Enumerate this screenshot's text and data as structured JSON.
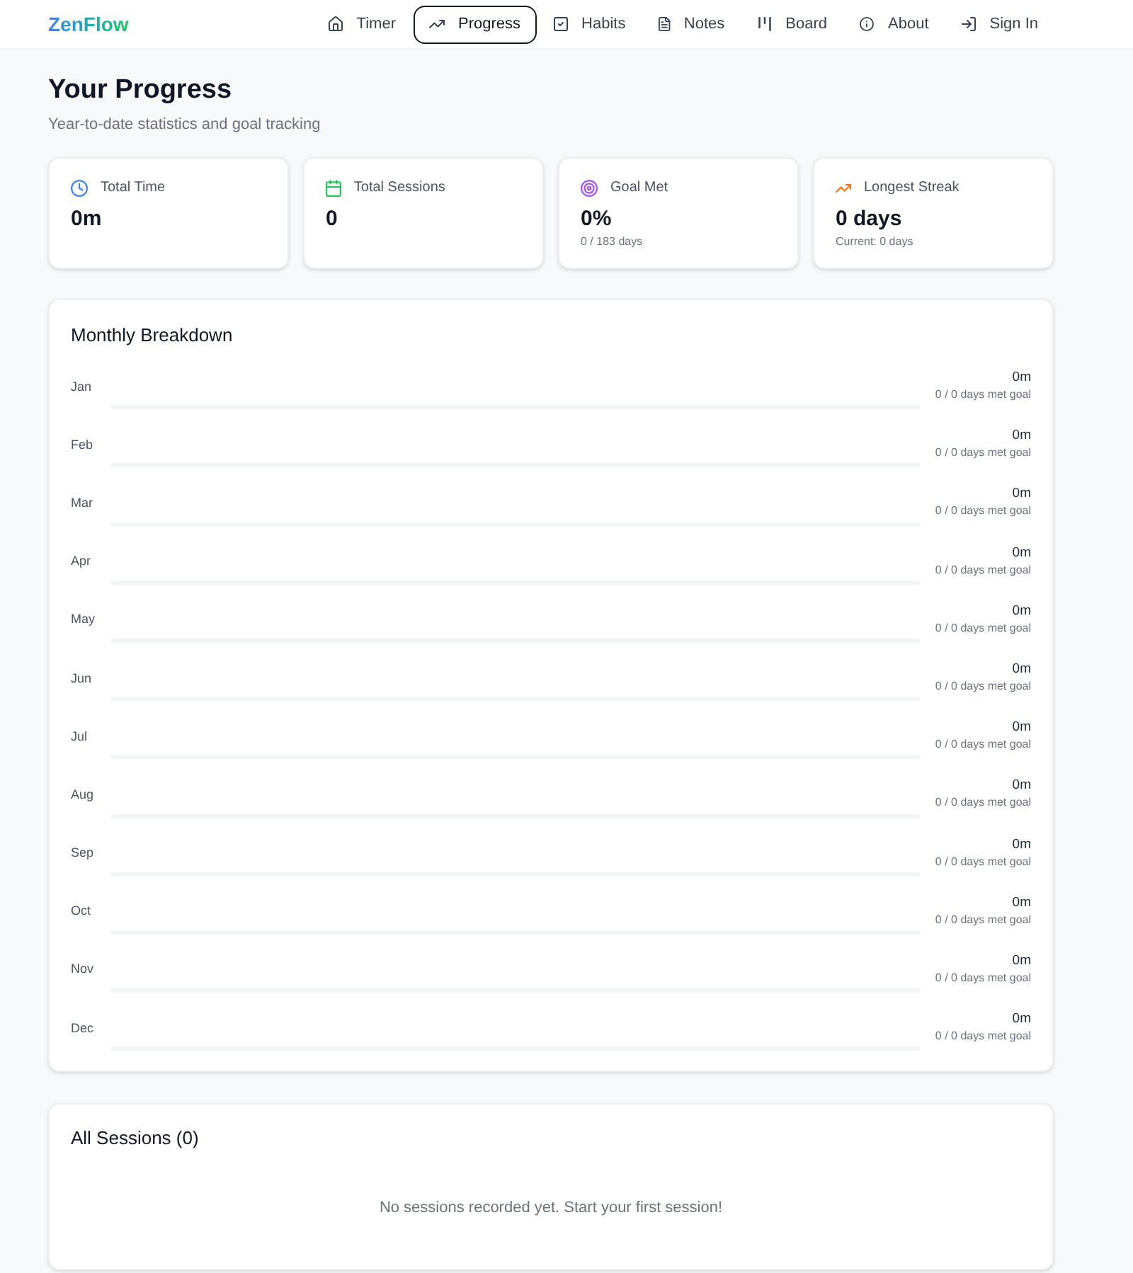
{
  "brand": {
    "name": "ZenFlow"
  },
  "nav": [
    {
      "kind": "home",
      "label": "Timer",
      "selected": false
    },
    {
      "kind": "trend",
      "label": "Progress",
      "selected": true
    },
    {
      "kind": "check-square",
      "label": "Habits",
      "selected": false
    },
    {
      "kind": "file",
      "label": "Notes",
      "selected": false
    },
    {
      "kind": "kanban",
      "label": "Board",
      "selected": false
    },
    {
      "kind": "info",
      "label": "About",
      "selected": false
    },
    {
      "kind": "sign-in",
      "label": "Sign In",
      "selected": false
    }
  ],
  "header": {
    "title": "Your Progress",
    "subtitle": "Year-to-date statistics and goal tracking"
  },
  "stats": [
    {
      "kind": "clock",
      "color": "#3b82f6",
      "label": "Total Time",
      "value": "0m"
    },
    {
      "kind": "calendar",
      "color": "#22c55e",
      "label": "Total Sessions",
      "value": "0"
    },
    {
      "kind": "target",
      "color": "#a855f7",
      "label": "Goal Met",
      "value": "0%",
      "note": "0 / 183 days"
    },
    {
      "kind": "trend",
      "color": "#f97316",
      "label": "Longest Streak",
      "value": "0 days",
      "note": "Current: 0 days"
    }
  ],
  "monthly": {
    "title": "Monthly Breakdown",
    "months": [
      {
        "label": "Jan",
        "total": "0m",
        "goal": "0 / 0 days met goal",
        "level": 0
      },
      {
        "label": "Feb",
        "total": "0m",
        "goal": "0 / 0 days met goal",
        "level": 0
      },
      {
        "label": "Mar",
        "total": "0m",
        "goal": "0 / 0 days met goal",
        "level": 0
      },
      {
        "label": "Apr",
        "total": "0m",
        "goal": "0 / 0 days met goal",
        "level": 0
      },
      {
        "label": "May",
        "total": "0m",
        "goal": "0 / 0 days met goal",
        "level": 0
      },
      {
        "label": "Jun",
        "total": "0m",
        "goal": "0 / 0 days met goal",
        "level": 0
      },
      {
        "label": "Jul",
        "total": "0m",
        "goal": "0 / 0 days met goal",
        "level": 0
      },
      {
        "label": "Aug",
        "total": "0m",
        "goal": "0 / 0 days met goal",
        "level": 0
      },
      {
        "label": "Sep",
        "total": "0m",
        "goal": "0 / 0 days met goal",
        "level": 0
      },
      {
        "label": "Oct",
        "total": "0m",
        "goal": "0 / 0 days met goal",
        "level": 0
      },
      {
        "label": "Nov",
        "total": "0m",
        "goal": "0 / 0 days met goal",
        "level": 0
      },
      {
        "label": "Dec",
        "total": "0m",
        "goal": "0 / 0 days met goal",
        "level": 0
      }
    ]
  },
  "sessions": {
    "title": "All Sessions (0)",
    "empty_message": "No sessions recorded yet. Start your first session!"
  }
}
